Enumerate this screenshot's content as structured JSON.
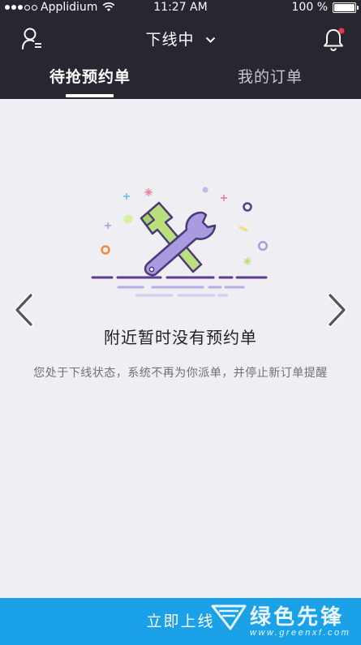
{
  "status_bar": {
    "carrier": "Applidium",
    "time": "11:27 AM",
    "battery": "100 %"
  },
  "header": {
    "status_toggle": "下线中",
    "user_icon": "user-list-icon",
    "bell_icon": "bell-icon",
    "bell_badge_color": "#e8364a"
  },
  "tabs": [
    {
      "label": "待抢预约单",
      "active": true
    },
    {
      "label": "我的订单",
      "active": false
    }
  ],
  "empty_state": {
    "illustration": "hammer-wrench-icon",
    "title": "附近暂时没有预约单",
    "description": "您处于下线状态，系统不再为你派单，并停止新订单提醒"
  },
  "footer": {
    "go_online_label": "立即上线"
  },
  "watermark": {
    "name": "绿色先锋",
    "url": "www.greenxf.com"
  },
  "colors": {
    "header_bg": "#272731",
    "body_bg": "#efeef2",
    "primary_button": "#1aa1e8",
    "illustration_purple": "#a99be0",
    "illustration_green": "#b9e07a",
    "outline": "#4a3a7a"
  }
}
